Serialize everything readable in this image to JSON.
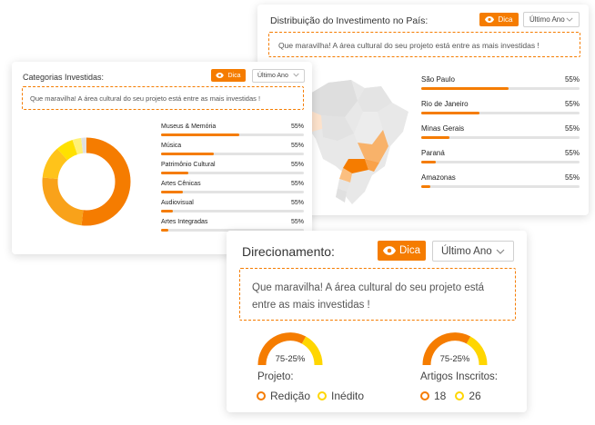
{
  "colors": {
    "accent": "#f57c00",
    "yellow": "#ffd600",
    "track": "#e3e3e3"
  },
  "distribuicao": {
    "title": "Distribuição do Investimento no País:",
    "dica_label": "Dica",
    "period": "Último Ano",
    "tip": "Que maravilha! A área cultural do seu projeto está entre as mais investidas !",
    "items": [
      {
        "label": "São Paulo",
        "pct": "55%",
        "fill": 0.55
      },
      {
        "label": "Rio de Janeiro",
        "pct": "55%",
        "fill": 0.37
      },
      {
        "label": "Minas Gerais",
        "pct": "55%",
        "fill": 0.18
      },
      {
        "label": "Paraná",
        "pct": "55%",
        "fill": 0.09
      },
      {
        "label": "Amazonas",
        "pct": "55%",
        "fill": 0.06
      }
    ]
  },
  "categorias": {
    "title": "Categorias Investidas:",
    "dica_label": "Dica",
    "period": "Último Ano",
    "tip": "Que maravilha! A área cultural do seu projeto está entre as mais investidas !",
    "items": [
      {
        "label": "Museus & Memória",
        "pct": "55%",
        "fill": 0.55
      },
      {
        "label": "Música",
        "pct": "55%",
        "fill": 0.37
      },
      {
        "label": "Patrimônio Cultural",
        "pct": "55%",
        "fill": 0.19
      },
      {
        "label": "Artes Cênicas",
        "pct": "55%",
        "fill": 0.15
      },
      {
        "label": "Audiovisual",
        "pct": "55%",
        "fill": 0.08
      },
      {
        "label": "Artes Integradas",
        "pct": "55%",
        "fill": 0.05
      }
    ]
  },
  "direcionamento": {
    "title": "Direcionamento:",
    "dica_label": "Dica",
    "period": "Último Ano",
    "tip": "Que maravilha! A área cultural do seu projeto está entre as mais investidas !",
    "projeto": {
      "gauge_label": "75-25%",
      "caption": "Projeto:",
      "legend": [
        "Redição",
        "Inédito"
      ]
    },
    "artigos": {
      "gauge_label": "75-25%",
      "caption": "Artigos Inscritos:",
      "legend": [
        "18",
        "26"
      ]
    }
  }
}
